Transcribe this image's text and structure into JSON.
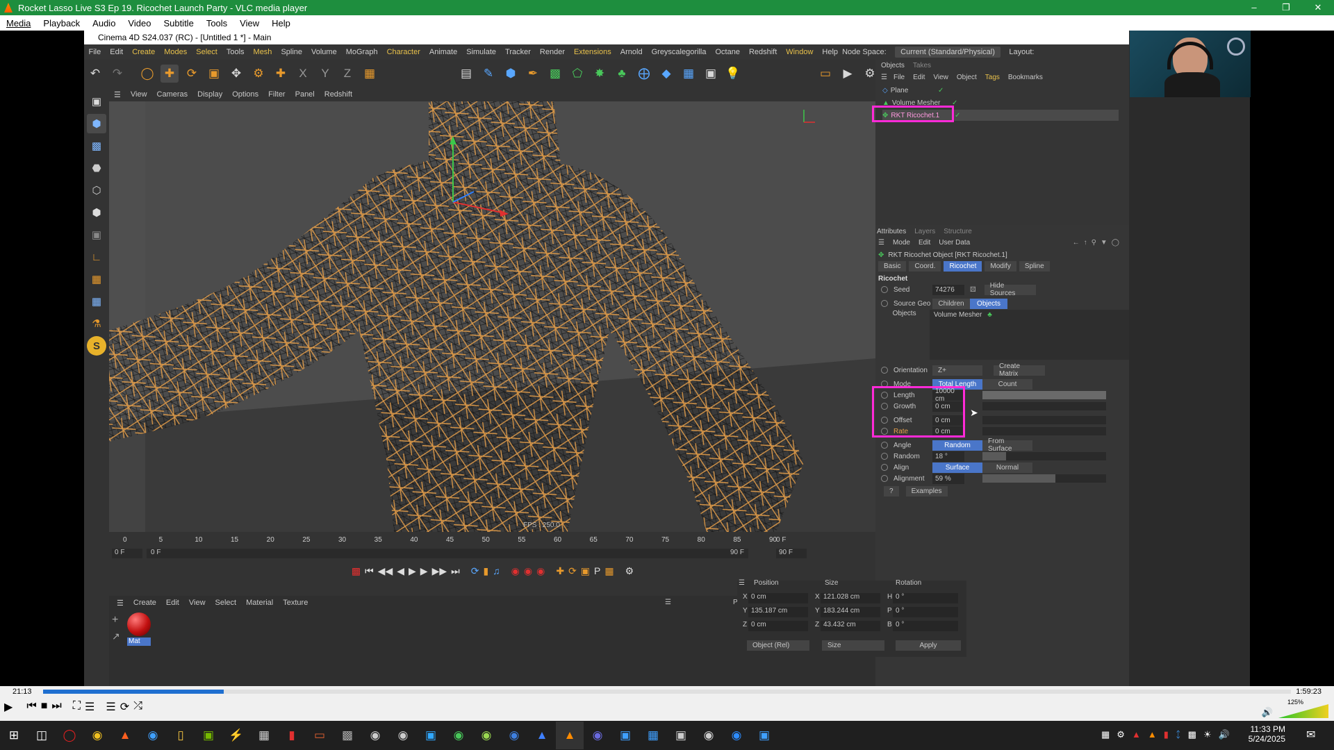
{
  "vlc": {
    "title": "Rocket Lasso Live S3 Ep 19. Ricochet Launch Party - VLC media player",
    "menu": [
      "Media",
      "Playback",
      "Audio",
      "Video",
      "Subtitle",
      "Tools",
      "View",
      "Help"
    ],
    "time_elapsed": "21:13",
    "time_total": "1:59:23",
    "seek_fraction": 0.145,
    "volume": "125%"
  },
  "c4d": {
    "title": "Cinema 4D S24.037 (RC) - [Untitled 1 *] - Main",
    "menu": [
      "File",
      "Edit",
      "Create",
      "Modes",
      "Select",
      "Tools",
      "Mesh",
      "Spline",
      "Volume",
      "MoGraph",
      "Character",
      "Animate",
      "Simulate",
      "Tracker",
      "Render",
      "Extensions",
      "Arnold",
      "Greyscalegorilla",
      "Octane",
      "Redshift",
      "Window",
      "Help"
    ],
    "node_space_label": "Node Space:",
    "node_space_value": "Current (Standard/Physical)",
    "layout_label": "Layout:",
    "viewport_menu": [
      "View",
      "Cameras",
      "Display",
      "Options",
      "Filter",
      "Panel",
      "Redshift"
    ],
    "fps": "FPS : 250.0",
    "timeline_ticks": [
      "0",
      "5",
      "10",
      "15",
      "20",
      "25",
      "30",
      "35",
      "40",
      "45",
      "50",
      "55",
      "60",
      "65",
      "70",
      "75",
      "80",
      "85",
      "90"
    ],
    "frame_current": "0 F",
    "frame_start": "0 F",
    "frame_start2": "0 F",
    "frame_end": "90 F",
    "frame_end2": "90 F",
    "frame_right": "0 F",
    "material_menu": [
      "Create",
      "Edit",
      "View",
      "Select",
      "Material",
      "Texture"
    ],
    "material_name": "Mat",
    "coords": {
      "headers": [
        "Position",
        "Size",
        "Rotation"
      ],
      "rows": [
        {
          "axis": "X",
          "pos": "0 cm",
          "saxis": "X",
          "size": "121.028 cm",
          "raxis": "H",
          "rot": "0 °"
        },
        {
          "axis": "Y",
          "pos": "135.187 cm",
          "saxis": "Y",
          "size": "183.244 cm",
          "raxis": "P",
          "rot": "0 °"
        },
        {
          "axis": "Z",
          "pos": "0 cm",
          "saxis": "Z",
          "size": "43.432 cm",
          "raxis": "B",
          "rot": "0 °"
        }
      ],
      "mode1": "Object (Rel)",
      "mode2": "Size",
      "apply": "Apply"
    },
    "objects": {
      "tabs": [
        "Objects",
        "Takes"
      ],
      "menu": [
        "File",
        "Edit",
        "View",
        "Object",
        "Tags",
        "Bookmarks"
      ],
      "items": [
        "Plane",
        "Volume Mesher",
        "RKT Ricochet.1"
      ]
    },
    "attributes": {
      "tabs": [
        "Attributes",
        "Layers",
        "Structure"
      ],
      "menu": [
        "Mode",
        "Edit",
        "User Data"
      ],
      "object_title": "RKT Ricochet Object [RKT Ricochet.1]",
      "subtabs": [
        "Basic",
        "Coord.",
        "Ricochet",
        "Modify",
        "Spline"
      ],
      "section": "Ricochet",
      "seed_label": "Seed",
      "seed_value": "74276",
      "hide_sources": "Hide Sources",
      "source_geo_label": "Source Geo",
      "source_children": "Children",
      "source_objects": "Objects",
      "objects_label": "Objects",
      "objects_value": "Volume Mesher",
      "orientation_label": "Orientation",
      "orientation_value": "Z+",
      "create_matrix": "Create Matrix",
      "mode_label": "Mode",
      "mode_total": "Total Length",
      "mode_count": "Count",
      "length_label": "Length",
      "length_value": "10000 cm",
      "growth_label": "Growth",
      "growth_value": "0 cm",
      "offset_label": "Offset",
      "offset_value": "0 cm",
      "rate_label": "Rate",
      "rate_value": "0 cm",
      "angle_label": "Angle",
      "angle_random": "Random",
      "angle_surface": "From Surface",
      "random_label": "Random",
      "random_value": "18 °",
      "random_fraction": 0.19,
      "align_label": "Align",
      "align_surface": "Surface",
      "align_normal": "Normal",
      "alignment_label": "Alignment",
      "alignment_value": "59 %",
      "alignment_fraction": 0.59,
      "help": "?",
      "examples": "Examples"
    }
  },
  "taskbar": {
    "time": "11:33 PM",
    "date": "5/24/2025"
  }
}
